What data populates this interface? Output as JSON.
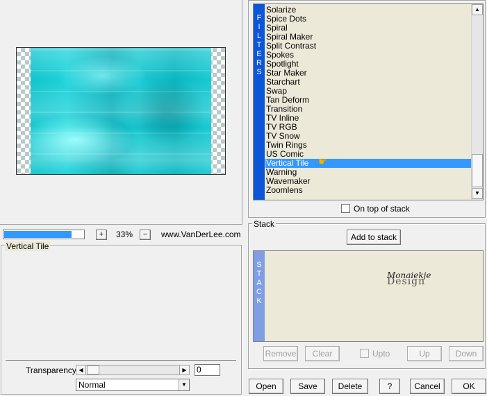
{
  "zoom": {
    "minus": "−",
    "plus": "+",
    "value": "33%",
    "progress_fraction": 0.85,
    "site": "www.VanDerLee.com"
  },
  "filters": {
    "title": "Filters",
    "sidebar_letters": [
      "F",
      "I",
      "L",
      "T",
      "E",
      "R",
      "S"
    ],
    "items": [
      "Solarize",
      "Spice Dots",
      "Spiral",
      "Spiral Maker",
      "Split Contrast",
      "Spokes",
      "Spotlight",
      "Star Maker",
      "Starchart",
      "Swap",
      "Tan Deform",
      "Transition",
      "TV Inline",
      "TV RGB",
      "TV Snow",
      "Twin Rings",
      "US Comic",
      "Vertical Tile",
      "Warning",
      "Wavemaker",
      "Zoomlens"
    ],
    "selected_index": 17,
    "on_top_label": "On top of stack"
  },
  "stack": {
    "title": "Stack",
    "add_label": "Add to stack",
    "sidebar_letters": [
      "S",
      "T",
      "A",
      "C",
      "K"
    ],
    "watermark_top": "Monaiekje",
    "watermark_bottom": "Design",
    "remove_label": "Remove",
    "clear_label": "Clear",
    "upto_label": "Upto",
    "up_label": "Up",
    "down_label": "Down"
  },
  "settings": {
    "title": "Vertical Tile",
    "transparency_label": "Transparency",
    "transparency_value": "0",
    "blend_mode": "Normal"
  },
  "footer": {
    "open": "Open",
    "save": "Save",
    "delete": "Delete",
    "help": "?",
    "cancel": "Cancel",
    "ok": "OK"
  },
  "colors": {
    "accent": "#3399ff",
    "filters_sidebar": "#0a56d6",
    "stack_sidebar": "#7f9ee6",
    "list_bg": "#ece9d8"
  },
  "icons": {
    "pointer": "hand-pointer-icon",
    "scroll_up": "arrow-up-icon",
    "scroll_down": "arrow-down-icon",
    "left": "arrow-left-icon",
    "right": "arrow-right-icon",
    "dropdown": "chevron-down-icon"
  }
}
